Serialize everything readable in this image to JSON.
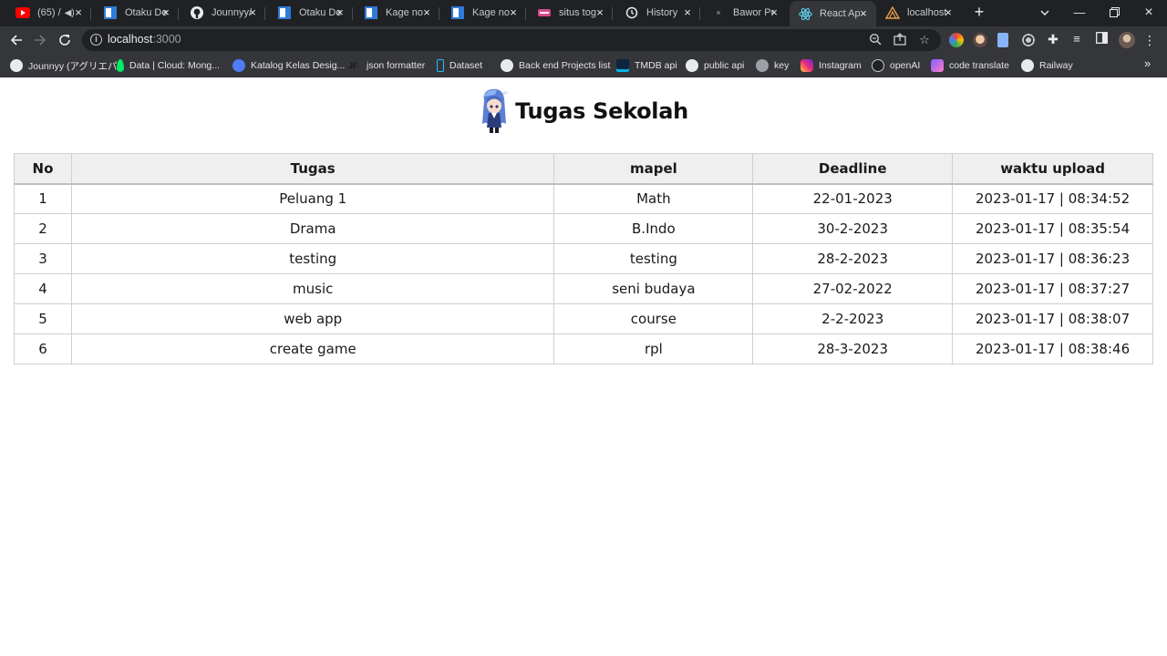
{
  "browser": {
    "tabs": [
      {
        "title": "(65) /",
        "favicon": "youtube-icon",
        "audio": true,
        "active": false
      },
      {
        "title": "Otaku De",
        "favicon": "otakudesu-icon",
        "active": false
      },
      {
        "title": "Jounnyy/",
        "favicon": "github-icon",
        "active": false
      },
      {
        "title": "Otaku De",
        "favicon": "otakudesu-icon",
        "active": false
      },
      {
        "title": "Kage no",
        "favicon": "otakudesu-icon",
        "active": false
      },
      {
        "title": "Kage no",
        "favicon": "otakudesu-icon",
        "active": false
      },
      {
        "title": "situs tog",
        "favicon": "site-icon",
        "active": false
      },
      {
        "title": "History",
        "favicon": "history-icon",
        "active": false
      },
      {
        "title": "Bawor Pr",
        "favicon": "site-icon",
        "active": false
      },
      {
        "title": "React Ap",
        "favicon": "react-icon",
        "active": true
      },
      {
        "title": "localhost",
        "favicon": "local-icon",
        "active": false
      }
    ],
    "address": {
      "host": "localhost",
      "port": ":3000"
    },
    "bookmarks": [
      {
        "label": "Jounnyy (アグリエパ)",
        "icon": "github-icon"
      },
      {
        "label": "Data | Cloud: Mong...",
        "icon": "mongodb-icon"
      },
      {
        "label": "Katalog Kelas Desig...",
        "icon": "katalog-icon"
      },
      {
        "label": "json formatter",
        "icon": "jf-icon"
      },
      {
        "label": "Dataset",
        "icon": "dataset-icon"
      },
      {
        "label": "Back end Projects list",
        "icon": "github-icon"
      },
      {
        "label": "TMDB api",
        "icon": "tmdb-icon"
      },
      {
        "label": "public api",
        "icon": "github-icon"
      },
      {
        "label": "key",
        "icon": "key-icon"
      },
      {
        "label": "Instagram",
        "icon": "instagram-icon"
      },
      {
        "label": "openAI",
        "icon": "openai-icon"
      },
      {
        "label": "code translate",
        "icon": "translate-icon"
      },
      {
        "label": "Railway",
        "icon": "railway-icon"
      }
    ]
  },
  "page": {
    "title": "Tugas Sekolah",
    "table": {
      "headers": {
        "no": "No",
        "tugas": "Tugas",
        "mapel": "mapel",
        "deadline": "Deadline",
        "upload": "waktu upload"
      },
      "rows": [
        {
          "no": "1",
          "tugas": "Peluang 1",
          "mapel": "Math",
          "deadline": "22-01-2023",
          "upload": "2023-01-17 | 08:34:52"
        },
        {
          "no": "2",
          "tugas": "Drama",
          "mapel": "B.Indo",
          "deadline": "30-2-2023",
          "upload": "2023-01-17 | 08:35:54"
        },
        {
          "no": "3",
          "tugas": "testing",
          "mapel": "testing",
          "deadline": "28-2-2023",
          "upload": "2023-01-17 | 08:36:23"
        },
        {
          "no": "4",
          "tugas": "music",
          "mapel": "seni budaya",
          "deadline": "27-02-2022",
          "upload": "2023-01-17 | 08:37:27"
        },
        {
          "no": "5",
          "tugas": "web app",
          "mapel": "course",
          "deadline": "2-2-2023",
          "upload": "2023-01-17 | 08:38:07"
        },
        {
          "no": "6",
          "tugas": "create game",
          "mapel": "rpl",
          "deadline": "28-3-2023",
          "upload": "2023-01-17 | 08:38:46"
        }
      ]
    }
  }
}
